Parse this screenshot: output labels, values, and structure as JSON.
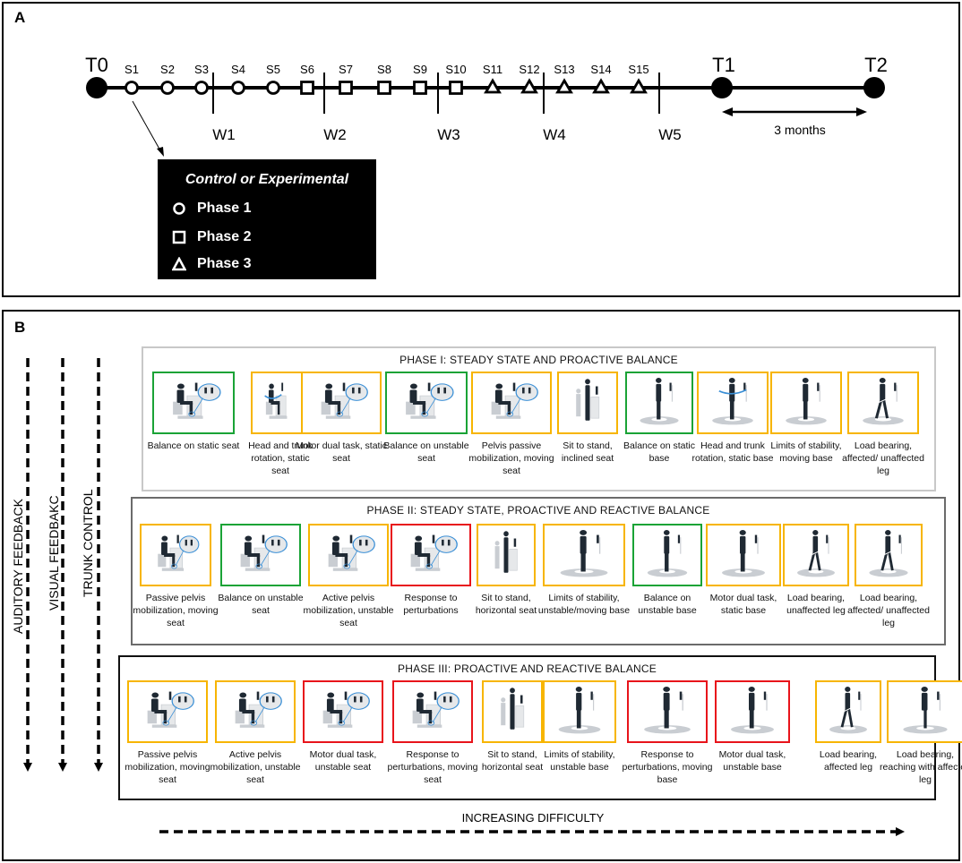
{
  "panelA": {
    "label": "A",
    "timepoints": [
      {
        "id": "T0",
        "label": "T0"
      },
      {
        "id": "T1",
        "label": "T1"
      },
      {
        "id": "T2",
        "label": "T2"
      }
    ],
    "sessions": [
      {
        "label": "S1",
        "shape": "circle"
      },
      {
        "label": "S2",
        "shape": "circle"
      },
      {
        "label": "S3",
        "shape": "circle"
      },
      {
        "label": "S4",
        "shape": "circle"
      },
      {
        "label": "S5",
        "shape": "circle"
      },
      {
        "label": "S6",
        "shape": "square"
      },
      {
        "label": "S7",
        "shape": "square"
      },
      {
        "label": "S8",
        "shape": "square"
      },
      {
        "label": "S9",
        "shape": "square"
      },
      {
        "label": "S10",
        "shape": "square"
      },
      {
        "label": "S11",
        "shape": "triangle"
      },
      {
        "label": "S12",
        "shape": "triangle"
      },
      {
        "label": "S13",
        "shape": "triangle"
      },
      {
        "label": "S14",
        "shape": "triangle"
      },
      {
        "label": "S15",
        "shape": "triangle"
      }
    ],
    "weeks": [
      "W1",
      "W2",
      "W3",
      "W4",
      "W5"
    ],
    "followup_label": "3 months",
    "legend": {
      "title": "Control or Experimental",
      "items": [
        {
          "shape": "circle",
          "label": "Phase 1"
        },
        {
          "shape": "square",
          "label": "Phase 2"
        },
        {
          "shape": "triangle",
          "label": "Phase 3"
        }
      ]
    }
  },
  "panelB": {
    "label": "B",
    "vertical_axes": [
      "AUDITORY FEEDBACK",
      "VISUAL FEEDBAKC",
      "TRUNK CONTROL"
    ],
    "horizontal_axis": "INCREASING DIFFICULTY",
    "colors": {
      "green": "#1aa336",
      "yellow": "#f7b500",
      "red": "#e8141b"
    },
    "phases": [
      {
        "title": "PHASE  I: STEADY STATE AND PROACTIVE BALANCE",
        "exercises": [
          {
            "caption": "Balance on static seat",
            "color": "green",
            "pose": "seated"
          },
          {
            "caption": "Head and trunk rotation, static seat",
            "color": "yellow",
            "pose": "seated-rotation"
          },
          {
            "caption": "Motor dual task, static seat",
            "color": "yellow",
            "pose": "seated"
          },
          {
            "caption": "Balance on unstable seat",
            "color": "green",
            "pose": "seated"
          },
          {
            "caption": "Pelvis passive mobilization, moving seat",
            "color": "yellow",
            "pose": "seated"
          },
          {
            "caption": "Sit to stand, inclined seat",
            "color": "yellow",
            "pose": "sit-to-stand"
          },
          {
            "caption": "Balance on static base",
            "color": "green",
            "pose": "standing"
          },
          {
            "caption": "Head and trunk rotation, static base",
            "color": "yellow",
            "pose": "standing-rotation"
          },
          {
            "caption": "Limits of stability, moving base",
            "color": "yellow",
            "pose": "standing"
          },
          {
            "caption": "Load bearing, affected/ unaffected leg",
            "color": "yellow",
            "pose": "stepping"
          }
        ]
      },
      {
        "title": "PHASE  II: STEADY STATE, PROACTIVE AND REACTIVE BALANCE",
        "exercises": [
          {
            "caption": "Passive pelvis mobilization, moving seat",
            "color": "yellow",
            "pose": "seated"
          },
          {
            "caption": "Balance on unstable seat",
            "color": "green",
            "pose": "seated"
          },
          {
            "caption": "Active pelvis mobilization, unstable seat",
            "color": "yellow",
            "pose": "seated"
          },
          {
            "caption": "Response to perturbations",
            "color": "red",
            "pose": "seated"
          },
          {
            "caption": "Sit to stand, horizontal seat",
            "color": "yellow",
            "pose": "sit-to-stand"
          },
          {
            "caption": "Limits of stability, unstable/moving base",
            "color": "yellow",
            "pose": "standing"
          },
          {
            "caption": "Balance on unstable base",
            "color": "green",
            "pose": "standing"
          },
          {
            "caption": "Motor dual task, static base",
            "color": "yellow",
            "pose": "standing"
          },
          {
            "caption": "Load bearing, unaffected leg",
            "color": "yellow",
            "pose": "stepping"
          },
          {
            "caption": "Load bearing, affected/ unaffected leg",
            "color": "yellow",
            "pose": "stepping"
          }
        ]
      },
      {
        "title": "PHASE  III: PROACTIVE AND REACTIVE BALANCE",
        "exercises": [
          {
            "caption": "Passive pelvis mobilization, moving seat",
            "color": "yellow",
            "pose": "seated"
          },
          {
            "caption": "Active pelvis mobilization, unstable seat",
            "color": "yellow",
            "pose": "seated"
          },
          {
            "caption": "Motor dual task, unstable seat",
            "color": "red",
            "pose": "seated"
          },
          {
            "caption": "Response to perturbations, moving seat",
            "color": "red",
            "pose": "seated"
          },
          {
            "caption": "Sit to stand, horizontal seat",
            "color": "yellow",
            "pose": "sit-to-stand"
          },
          {
            "caption": "Limits of stability, unstable base",
            "color": "yellow",
            "pose": "standing"
          },
          {
            "caption": "Response to perturbations, moving base",
            "color": "red",
            "pose": "standing"
          },
          {
            "caption": "Motor dual task, unstable base",
            "color": "red",
            "pose": "standing"
          },
          {
            "caption": "Load bearing, affected leg",
            "color": "yellow",
            "pose": "stepping"
          },
          {
            "caption": "Load bearing, reaching with affected leg",
            "color": "yellow",
            "pose": "reaching"
          }
        ]
      }
    ]
  }
}
